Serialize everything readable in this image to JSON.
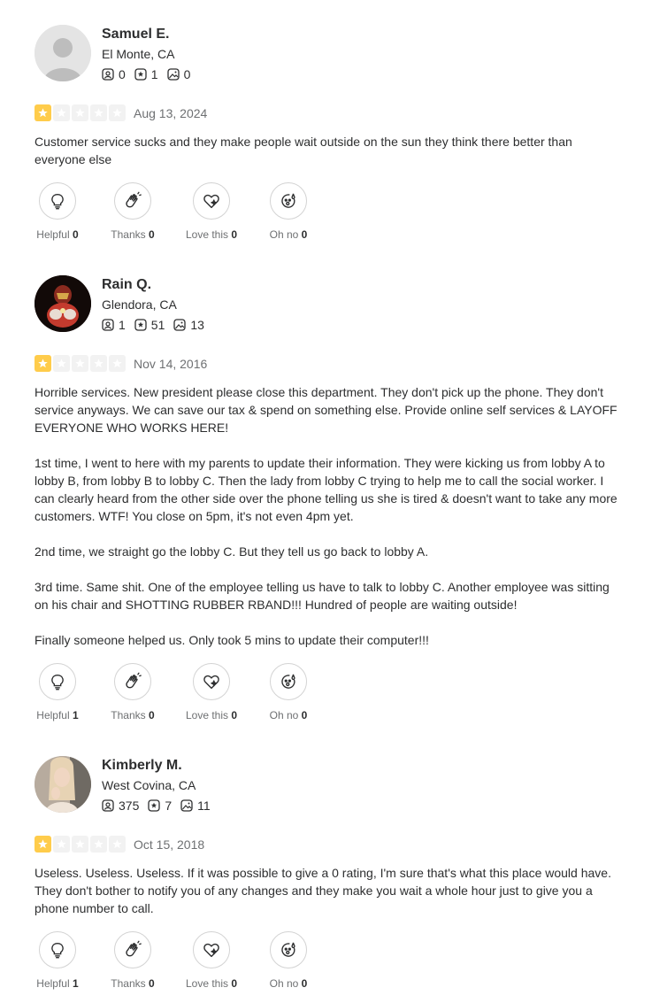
{
  "reviews": [
    {
      "user": {
        "name": "Samuel E.",
        "location": "El Monte, CA",
        "friends": "0",
        "reviews": "1",
        "photos": "0"
      },
      "rating": 1,
      "date": "Aug 13, 2024",
      "paragraphs": [
        "Customer service sucks and they make people wait outside on the sun they think there better than everyone else"
      ],
      "reactions": {
        "helpful_label": "Helpful",
        "helpful": "0",
        "thanks_label": "Thanks",
        "thanks": "0",
        "love_label": "Love this",
        "love": "0",
        "ohno_label": "Oh no",
        "ohno": "0"
      }
    },
    {
      "user": {
        "name": "Rain Q.",
        "location": "Glendora, CA",
        "friends": "1",
        "reviews": "51",
        "photos": "13"
      },
      "rating": 1,
      "date": "Nov 14, 2016",
      "paragraphs": [
        "Horrible services. New president please close this department. They don't pick up the phone. They don't service anyways. We can save our tax & spend on something else. Provide online self services & LAYOFF EVERYONE WHO WORKS HERE!",
        "1st time, I went to here with my parents to update their information. They were kicking us from lobby A to lobby B, from lobby B to lobby C. Then the lady from lobby C trying to help me to call the social worker. I can clearly heard from the other side over the phone telling us she is tired & doesn't want to take any more customers. WTF! You close on 5pm, it's not even 4pm yet.",
        "2nd time, we straight go the lobby C. But they tell us go back to lobby A.",
        "3rd time. Same shit. One of the employee telling us have to talk to lobby C. Another employee was sitting on his chair and SHOTTING RUBBER RBAND!!! Hundred of people are waiting outside!",
        "Finally someone helped us. Only took 5 mins to update their computer!!!"
      ],
      "reactions": {
        "helpful_label": "Helpful",
        "helpful": "1",
        "thanks_label": "Thanks",
        "thanks": "0",
        "love_label": "Love this",
        "love": "0",
        "ohno_label": "Oh no",
        "ohno": "0"
      }
    },
    {
      "user": {
        "name": "Kimberly M.",
        "location": "West Covina, CA",
        "friends": "375",
        "reviews": "7",
        "photos": "11"
      },
      "rating": 1,
      "date": "Oct 15, 2018",
      "paragraphs": [
        "Useless. Useless. Useless. If it was possible to give a 0 rating, I'm sure that's what this place would have. They don't bother to notify you of any changes and they make you wait a whole hour just to give you a phone number to call."
      ],
      "reactions": {
        "helpful_label": "Helpful",
        "helpful": "1",
        "thanks_label": "Thanks",
        "thanks": "0",
        "love_label": "Love this",
        "love": "0",
        "ohno_label": "Oh no",
        "ohno": "0"
      }
    }
  ],
  "icons": {
    "friends": "friends-icon",
    "reviews": "review-star-icon",
    "photos": "photo-icon",
    "helpful": "lightbulb-icon",
    "thanks": "clapping-hands-icon",
    "love": "heart-sparkle-icon",
    "ohno": "shocked-face-icon",
    "avatar_default": "default-avatar-icon"
  },
  "colors": {
    "star_on": "#ffcc4b",
    "star_off": "#f2f2f2",
    "text": "#2d2e2f",
    "muted": "#6e7072"
  }
}
